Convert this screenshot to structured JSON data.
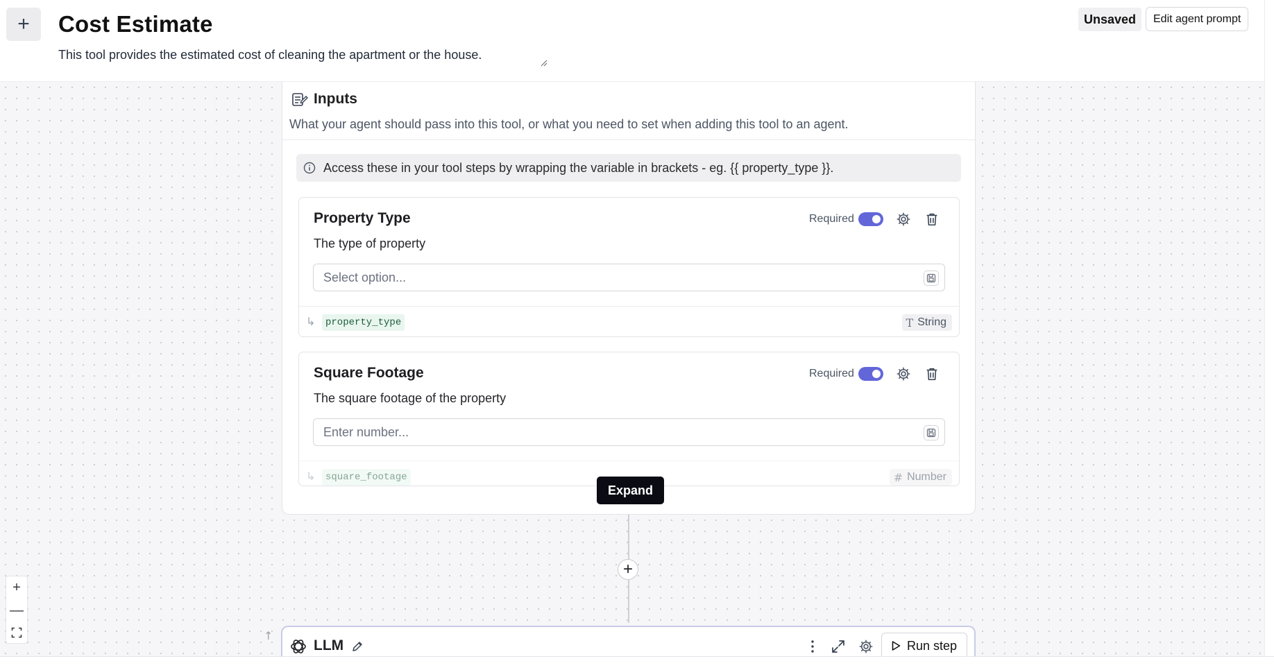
{
  "header": {
    "add_button_glyph": "+",
    "title": "Cost Estimate",
    "description": "This tool provides the estimated cost of cleaning the apartment or the house.",
    "status_badge": "Unsaved",
    "edit_prompt_label": "Edit agent prompt"
  },
  "inputs": {
    "title": "Inputs",
    "subtitle": "What your agent should pass into this tool, or what you need to set when adding this tool to an agent.",
    "info_text": "Access these in your tool steps by wrapping the variable in brackets - eg. {{ property_type }}.",
    "fields": [
      {
        "name": "Property Type",
        "description": "The type of property",
        "required_label": "Required",
        "required": true,
        "placeholder": "Select option...",
        "variable": "property_type",
        "type_glyph": "T",
        "type_label": "String"
      },
      {
        "name": "Square Footage",
        "description": "The square footage of the property",
        "required_label": "Required",
        "required": true,
        "placeholder": "Enter number...",
        "variable": "square_footage",
        "type_glyph": "#",
        "type_label": "Number"
      }
    ]
  },
  "tooltip": {
    "expand_label": "Expand"
  },
  "connector": {
    "add_glyph": "+"
  },
  "zoom": {
    "in_glyph": "+",
    "out_glyph": "—"
  },
  "llm_step": {
    "title": "LLM",
    "run_label": "Run step"
  },
  "colors": {
    "accent_toggle": "#6366d9",
    "tooltip_bg": "#0b0b14",
    "variable_chip_bg": "#e9f6ef"
  },
  "icons": {
    "inputs": "inputs-form-icon",
    "info": "info-circle-icon",
    "settings": "gear-icon",
    "delete": "trash-icon",
    "save_variable": "save-icon",
    "llm": "openai-icon",
    "edit": "pencil-icon",
    "more": "kebab-menu-icon",
    "expand": "expand-arrows-icon",
    "run": "play-icon",
    "fit_view": "fit-view-icon"
  }
}
